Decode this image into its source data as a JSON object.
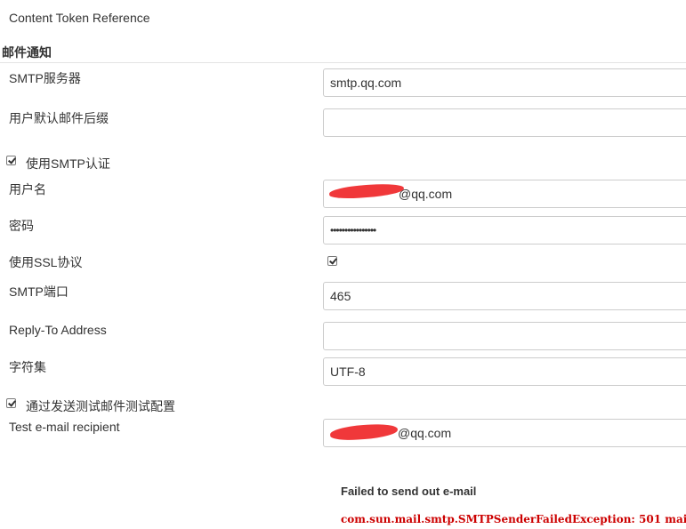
{
  "link": {
    "content_token_reference": "Content Token Reference"
  },
  "section": {
    "title": "邮件通知"
  },
  "fields": {
    "smtp_server": {
      "label": "SMTP服务器",
      "value": "smtp.qq.com"
    },
    "default_suffix": {
      "label": "用户默认邮件后缀",
      "value": ""
    },
    "use_smtp_auth": {
      "label": "使用SMTP认证",
      "checked": true
    },
    "username": {
      "label": "用户名",
      "value_visible": "@qq.com"
    },
    "password": {
      "label": "密码",
      "value": "••••••••••••••••"
    },
    "use_ssl": {
      "label": "使用SSL协议",
      "checked": true
    },
    "smtp_port": {
      "label": "SMTP端口",
      "value": "465"
    },
    "reply_to": {
      "label": "Reply-To Address",
      "value": ""
    },
    "charset": {
      "label": "字符集",
      "value": "UTF-8"
    },
    "test_config": {
      "label": "通过发送测试邮件测试配置",
      "checked": true
    },
    "test_recipient": {
      "label": "Test e-mail recipient",
      "value_visible": "@qq.com"
    }
  },
  "result": {
    "title": "Failed to send out e-mail",
    "message": "com.sun.mail.smtp.SMTPSenderFailedException: 501 mail"
  },
  "colors": {
    "error": "#cc0000",
    "redaction": "#f0383a"
  }
}
